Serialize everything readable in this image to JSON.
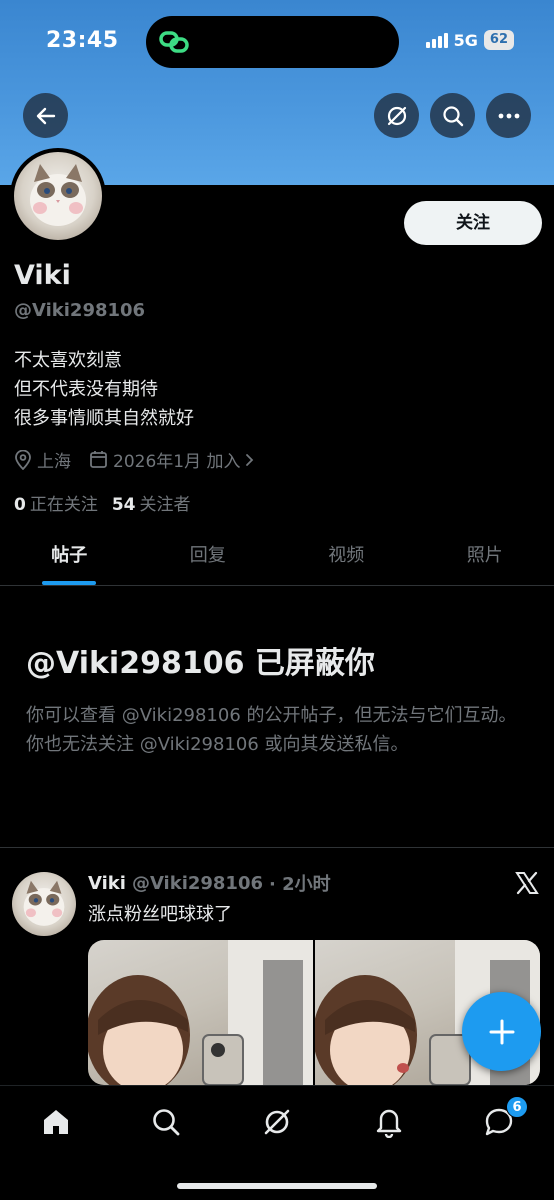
{
  "status_bar": {
    "time": "23:45",
    "network": "5G",
    "battery": "62"
  },
  "profile": {
    "name": "Viki",
    "handle": "@Viki298106",
    "follow_label": "关注",
    "bio": [
      "不太喜欢刻意",
      "但不代表没有期待",
      "很多事情顺其自然就好"
    ],
    "location": "上海",
    "joined": "2026年1月 加入",
    "following_count": "0",
    "following_label": "正在关注",
    "followers_count": "54",
    "followers_label": "关注者"
  },
  "tabs": [
    {
      "label": "帖子",
      "active": true
    },
    {
      "label": "回复",
      "active": false
    },
    {
      "label": "视频",
      "active": false
    },
    {
      "label": "照片",
      "active": false
    }
  ],
  "blocked": {
    "title": "@Viki298106 已屏蔽你",
    "description": "你可以查看 @Viki298106 的公开帖子，但无法与它们互动。你也无法关注 @Viki298106 或向其发送私信。"
  },
  "post": {
    "name": "Viki",
    "handle": "@Viki298106",
    "time": "· 2小时",
    "text": "涨点粉丝吧球球了"
  },
  "nav": {
    "messages_badge": "6"
  },
  "icons": [
    "back-arrow-icon",
    "grok-icon",
    "search-icon",
    "more-icon",
    "location-pin-icon",
    "calendar-icon",
    "chevron-right-icon",
    "x-logo-icon",
    "plus-icon",
    "home-icon",
    "search-icon",
    "grok-icon",
    "bell-icon",
    "messages-icon"
  ],
  "colors": {
    "accent": "#1d9bf0",
    "banner": "#4c98de",
    "background": "#000000",
    "muted": "#71767b"
  }
}
